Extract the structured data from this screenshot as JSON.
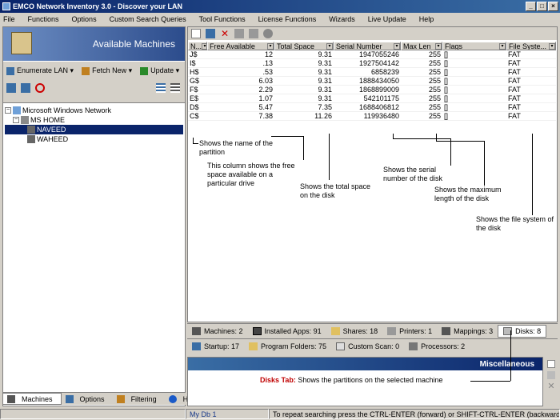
{
  "window": {
    "title": "EMCO Network Inventory 3.0 - Discover your LAN"
  },
  "menu": [
    "File",
    "Functions",
    "Options",
    "Custom Search Queries",
    "Tool Functions",
    "License Functions",
    "Wizards",
    "Live Update",
    "Help"
  ],
  "left": {
    "header": "Available Machines",
    "toolbar": {
      "enumerate": "Enumerate LAN",
      "fetch": "Fetch New",
      "update": "Update"
    },
    "tree": {
      "root": "Microsoft Windows Network",
      "group": "MS HOME",
      "machines": [
        "NAVEED",
        "WAHEED"
      ]
    },
    "tabs": [
      "Machines",
      "Options",
      "Filtering",
      "Help"
    ]
  },
  "grid": {
    "headers": [
      "N...",
      "Free Available",
      "Total Space",
      "Serial Number",
      "Max Len",
      "Flags",
      "File Syste..."
    ],
    "rows": [
      [
        "J$",
        "12",
        "9.31",
        "1947055246",
        "255",
        "[]",
        "FAT"
      ],
      [
        "I$",
        ".13",
        "9.31",
        "1927504142",
        "255",
        "[]",
        "FAT"
      ],
      [
        "H$",
        ".53",
        "9.31",
        "6858239",
        "255",
        "[]",
        "FAT"
      ],
      [
        "G$",
        "6.03",
        "9.31",
        "1888434050",
        "255",
        "[]",
        "FAT"
      ],
      [
        "F$",
        "2.29",
        "9.31",
        "1868899009",
        "255",
        "[]",
        "FAT"
      ],
      [
        "E$",
        "1.07",
        "9.31",
        "542101175",
        "255",
        "[]",
        "FAT"
      ],
      [
        "D$",
        "5.47",
        "7.35",
        "1688406812",
        "255",
        "[]",
        "FAT"
      ],
      [
        "C$",
        "7.38",
        "11.26",
        "119936480",
        "255",
        "[]",
        "FAT"
      ]
    ]
  },
  "annotations": {
    "name": "Shows the name of the partition",
    "free": "This column shows the free space available on a particular drive",
    "total": "Shows the total space on the disk",
    "serial": "Shows the serial number of the disk",
    "maxlen": "Shows the maximum length of the disk",
    "fs": "Shows the file system of the disk",
    "disks_label": "Disks Tab:",
    "disks_text": " Shows the partitions on the selected machine"
  },
  "bottom_tabs_1": [
    "Machines: 2",
    "Installed Apps: 91",
    "Shares: 18",
    "Printers: 1",
    "Mappings: 3",
    "Disks: 8"
  ],
  "bottom_tabs_2": [
    "Startup: 17",
    "Program Folders: 75",
    "Custom Scan: 0",
    "Processors: 2"
  ],
  "misc": {
    "title": "Miscellaneous"
  },
  "status": {
    "db": "My Db 1",
    "hint": "To repeat searching press the CTRL-ENTER (forward) or SHIFT-CTRL-ENTER (backward) keys."
  },
  "colors": {
    "selection": "#0a246a",
    "accent_red": "#c00000"
  }
}
